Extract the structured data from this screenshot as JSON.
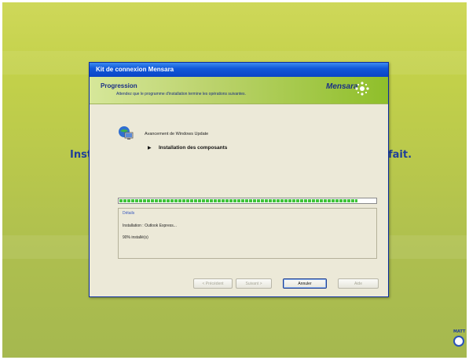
{
  "background": {
    "left_text": "Inst",
    "right_text": "fait.",
    "corner_logo_label": "MATT"
  },
  "window": {
    "title": "Kit de connexion Mensara",
    "header": {
      "title": "Progression",
      "subtitle": "Attendez que le programme d'installation termine les opérations suivantes.",
      "brand": "Mensara"
    },
    "step": {
      "title": "Avancement de Windows Update",
      "current_item": "Installation des composants"
    },
    "progress": {
      "percent": 93
    },
    "details": {
      "title": "Détails",
      "line1": "Installation : Outlook Express...",
      "line2": "90% installé(s)"
    },
    "buttons": {
      "previous": "< Précédent",
      "next": "Suivant >",
      "cancel": "Annuler",
      "help": "Aide"
    }
  },
  "colors": {
    "accent": "#1159d9",
    "progress": "#3fc43a",
    "brand_text": "#1a2f85",
    "background_green": "#b9c84c"
  }
}
